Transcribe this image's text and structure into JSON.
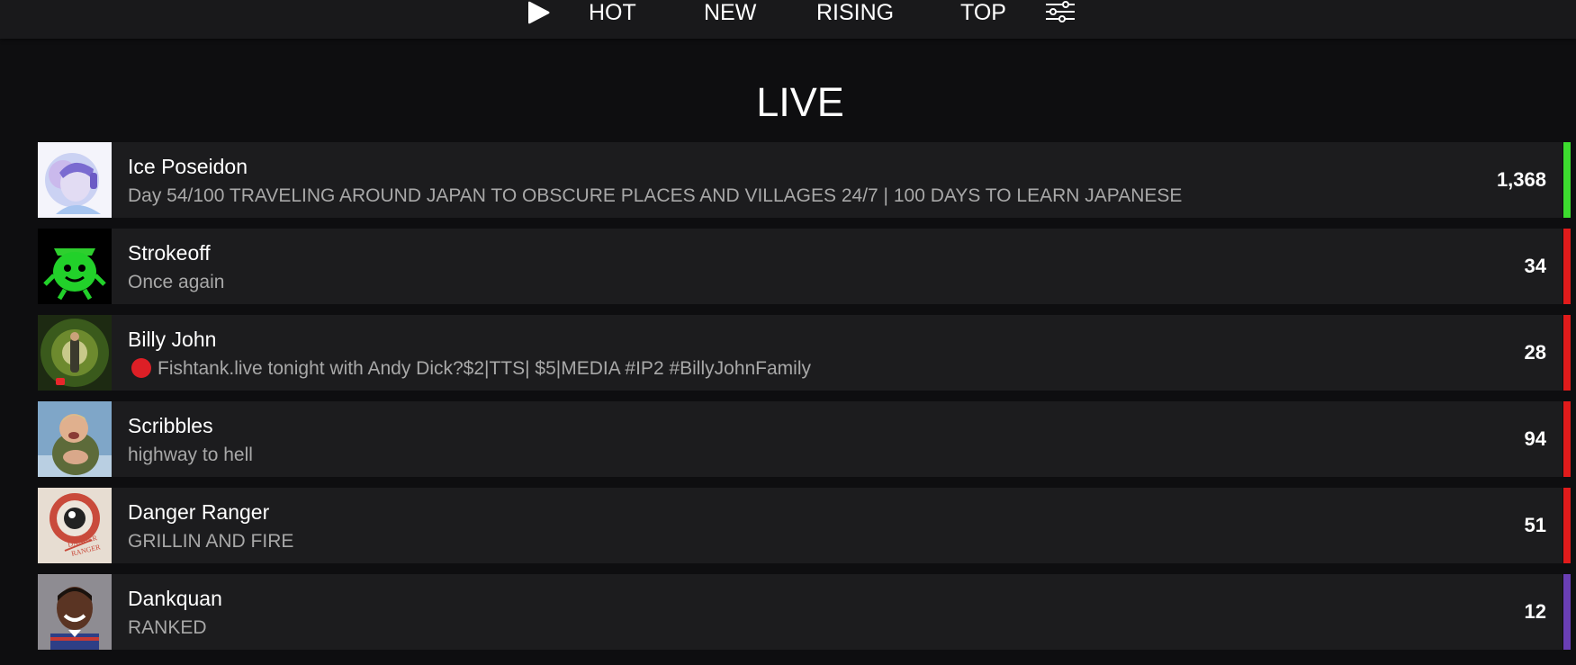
{
  "nav": {
    "tabs": [
      "HOT",
      "NEW",
      "RISING",
      "TOP"
    ],
    "play_icon": "play-icon",
    "filter_icon": "sliders-icon"
  },
  "section": {
    "title": "LIVE"
  },
  "streams": [
    {
      "name": "Ice Poseidon",
      "title": "Day 54/100 TRAVELING AROUND JAPAN TO OBSCURE PLACES AND VILLAGES 24/7 | 100 DAYS TO LEARN JAPANESE",
      "viewers": "1,368",
      "status_color": "#3ddc2f"
    },
    {
      "name": "Strokeoff",
      "title": "Once again",
      "viewers": "34",
      "status_color": "#e01b1b"
    },
    {
      "name": "Billy John",
      "title": "Fishtank.live tonight with Andy Dick?$2|TTS| $5|MEDIA #IP2 #BillyJohnFamily",
      "title_prefix_icon": "red-circle-icon",
      "viewers": "28",
      "status_color": "#e01b1b"
    },
    {
      "name": "Scribbles",
      "title": "highway to hell",
      "viewers": "94",
      "status_color": "#e01b1b"
    },
    {
      "name": "Danger Ranger",
      "title": "GRILLIN AND FIRE",
      "viewers": "51",
      "status_color": "#e01b1b"
    },
    {
      "name": "Dankquan",
      "title": "RANKED",
      "viewers": "12",
      "status_color": "#6a3fb5"
    }
  ],
  "thumbnail_art_text": {
    "danger_ranger": "DANGER RANGER"
  }
}
